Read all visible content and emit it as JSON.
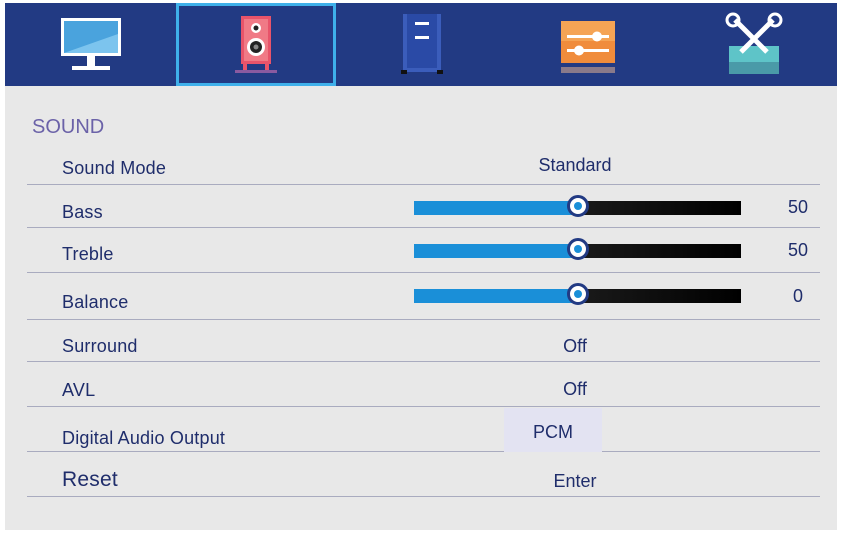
{
  "tabs": [
    {
      "icon": "picture-monitor-icon",
      "selected": false
    },
    {
      "icon": "speaker-icon",
      "selected": true
    },
    {
      "icon": "channel-tuner-icon",
      "selected": false
    },
    {
      "icon": "settings-sliders-icon",
      "selected": false
    },
    {
      "icon": "tools-icon",
      "selected": false
    }
  ],
  "colors": {
    "topbar": "#223a83",
    "selection_border": "#3fb0ea",
    "background": "#e8e8e8",
    "text": "#1f2d6b",
    "section_title": "#6b62a8",
    "slider_fill": "#1a8fd8"
  },
  "sound": {
    "title": "SOUND",
    "sound_mode": {
      "label": "Sound Mode",
      "value": "Standard"
    },
    "bass": {
      "label": "Bass",
      "value": "50",
      "level": 0.5
    },
    "treble": {
      "label": "Treble",
      "value": "50",
      "level": 0.5
    },
    "balance": {
      "label": "Balance",
      "value": "0",
      "level": 0.5
    },
    "surround": {
      "label": "Surround",
      "value": "Off"
    },
    "avl": {
      "label": "AVL",
      "value": "Off"
    },
    "digital_audio_output": {
      "label": "Digital Audio Output",
      "value": "PCM"
    },
    "reset": {
      "label": "Reset",
      "value": "Enter"
    }
  }
}
